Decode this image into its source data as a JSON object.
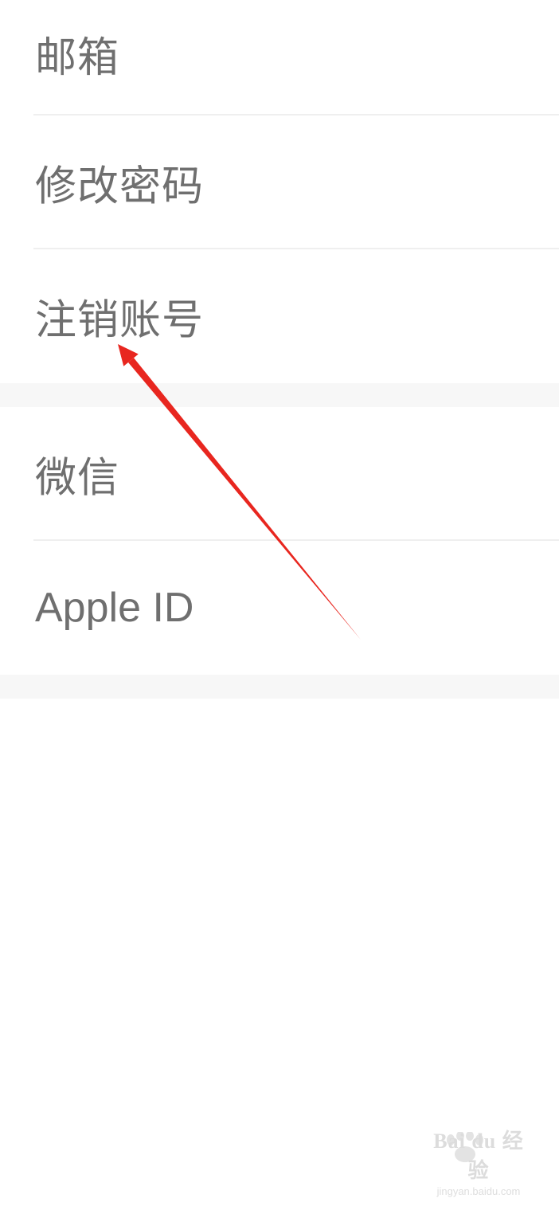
{
  "account_section": {
    "items": [
      {
        "label": "邮箱"
      },
      {
        "label": "修改密码"
      },
      {
        "label": "注销账号"
      }
    ]
  },
  "binding_section": {
    "items": [
      {
        "label": "微信"
      },
      {
        "label": "Apple ID"
      }
    ]
  },
  "annotation": {
    "color": "#e8261f",
    "target": "注销账号"
  },
  "watermark": {
    "brand": "Bai du 经验",
    "domain": "jingyan.baidu.com",
    "color": "#dcdcdc"
  }
}
